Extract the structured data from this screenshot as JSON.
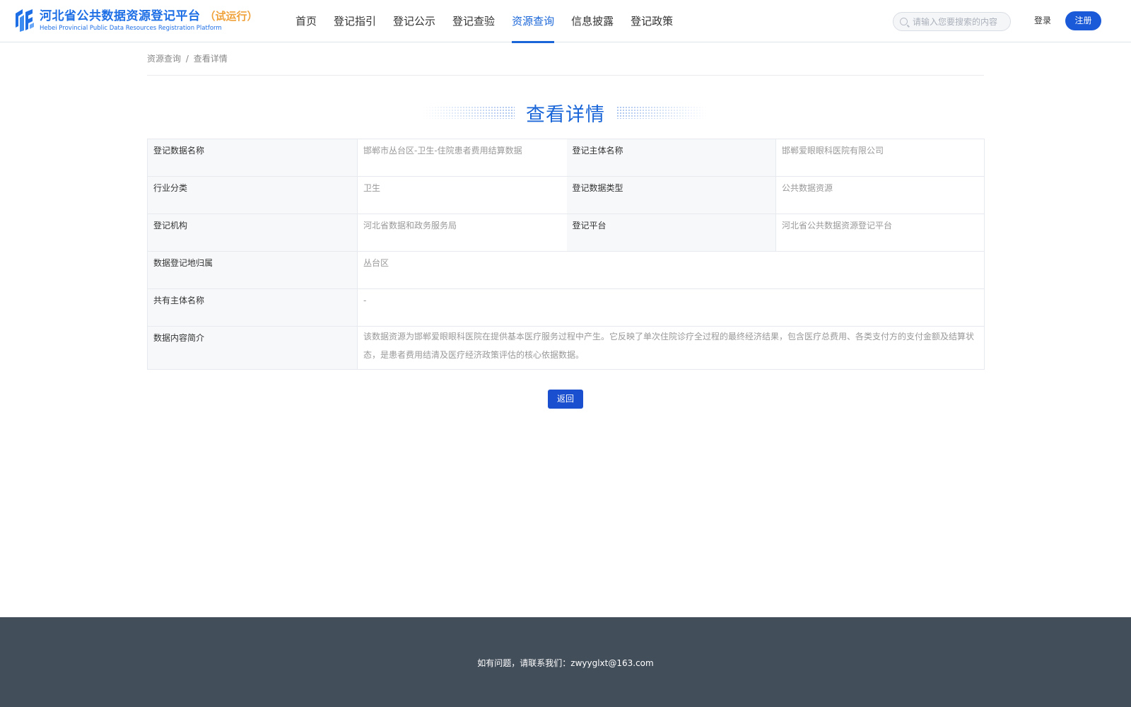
{
  "header": {
    "logo_cn": "河北省公共数据资源登记平台",
    "logo_trial": "（试运行）",
    "logo_en": "Hebei Provincial Public Data Resources Registration Platform",
    "nav": [
      {
        "label": "首页",
        "active": false
      },
      {
        "label": "登记指引",
        "active": false
      },
      {
        "label": "登记公示",
        "active": false
      },
      {
        "label": "登记查验",
        "active": false
      },
      {
        "label": "资源查询",
        "active": true
      },
      {
        "label": "信息披露",
        "active": false
      },
      {
        "label": "登记政策",
        "active": false
      }
    ],
    "search_placeholder": "请输入您要搜索的内容",
    "login_label": "登录",
    "register_label": "注册"
  },
  "breadcrumb": {
    "parent": "资源查询",
    "separator": "/",
    "current": "查看详情"
  },
  "page_title": "查看详情",
  "details": {
    "row1": {
      "label1": "登记数据名称",
      "value1": "邯郸市丛台区-卫生-住院患者费用结算数据",
      "label2": "登记主体名称",
      "value2": "邯郸爱眼眼科医院有限公司"
    },
    "row2": {
      "label1": "行业分类",
      "value1": "卫生",
      "label2": "登记数据类型",
      "value2": "公共数据资源"
    },
    "row3": {
      "label1": "登记机构",
      "value1": "河北省数据和政务服务局",
      "label2": "登记平台",
      "value2": "河北省公共数据资源登记平台"
    },
    "row4": {
      "label": "数据登记地归属",
      "value": "丛台区"
    },
    "row5": {
      "label": "共有主体名称",
      "value": "-"
    },
    "row6": {
      "label": "数据内容简介",
      "value": "该数据资源为邯郸爱眼眼科医院在提供基本医疗服务过程中产生。它反映了单次住院诊疗全过程的最终经济结果，包含医疗总费用、各类支付方的支付金额及结算状态，是患者费用结清及医疗经济政策评估的核心依据数据。"
    }
  },
  "back_label": "返回",
  "footer": {
    "contact": "如有问题，请联系我们：zwyyglxt@163.com"
  },
  "colors": {
    "brand_blue": "#1a66d8",
    "button_blue": "#1a4fcf",
    "trial_orange": "#f0a23c",
    "footer_bg": "#434e5b"
  }
}
